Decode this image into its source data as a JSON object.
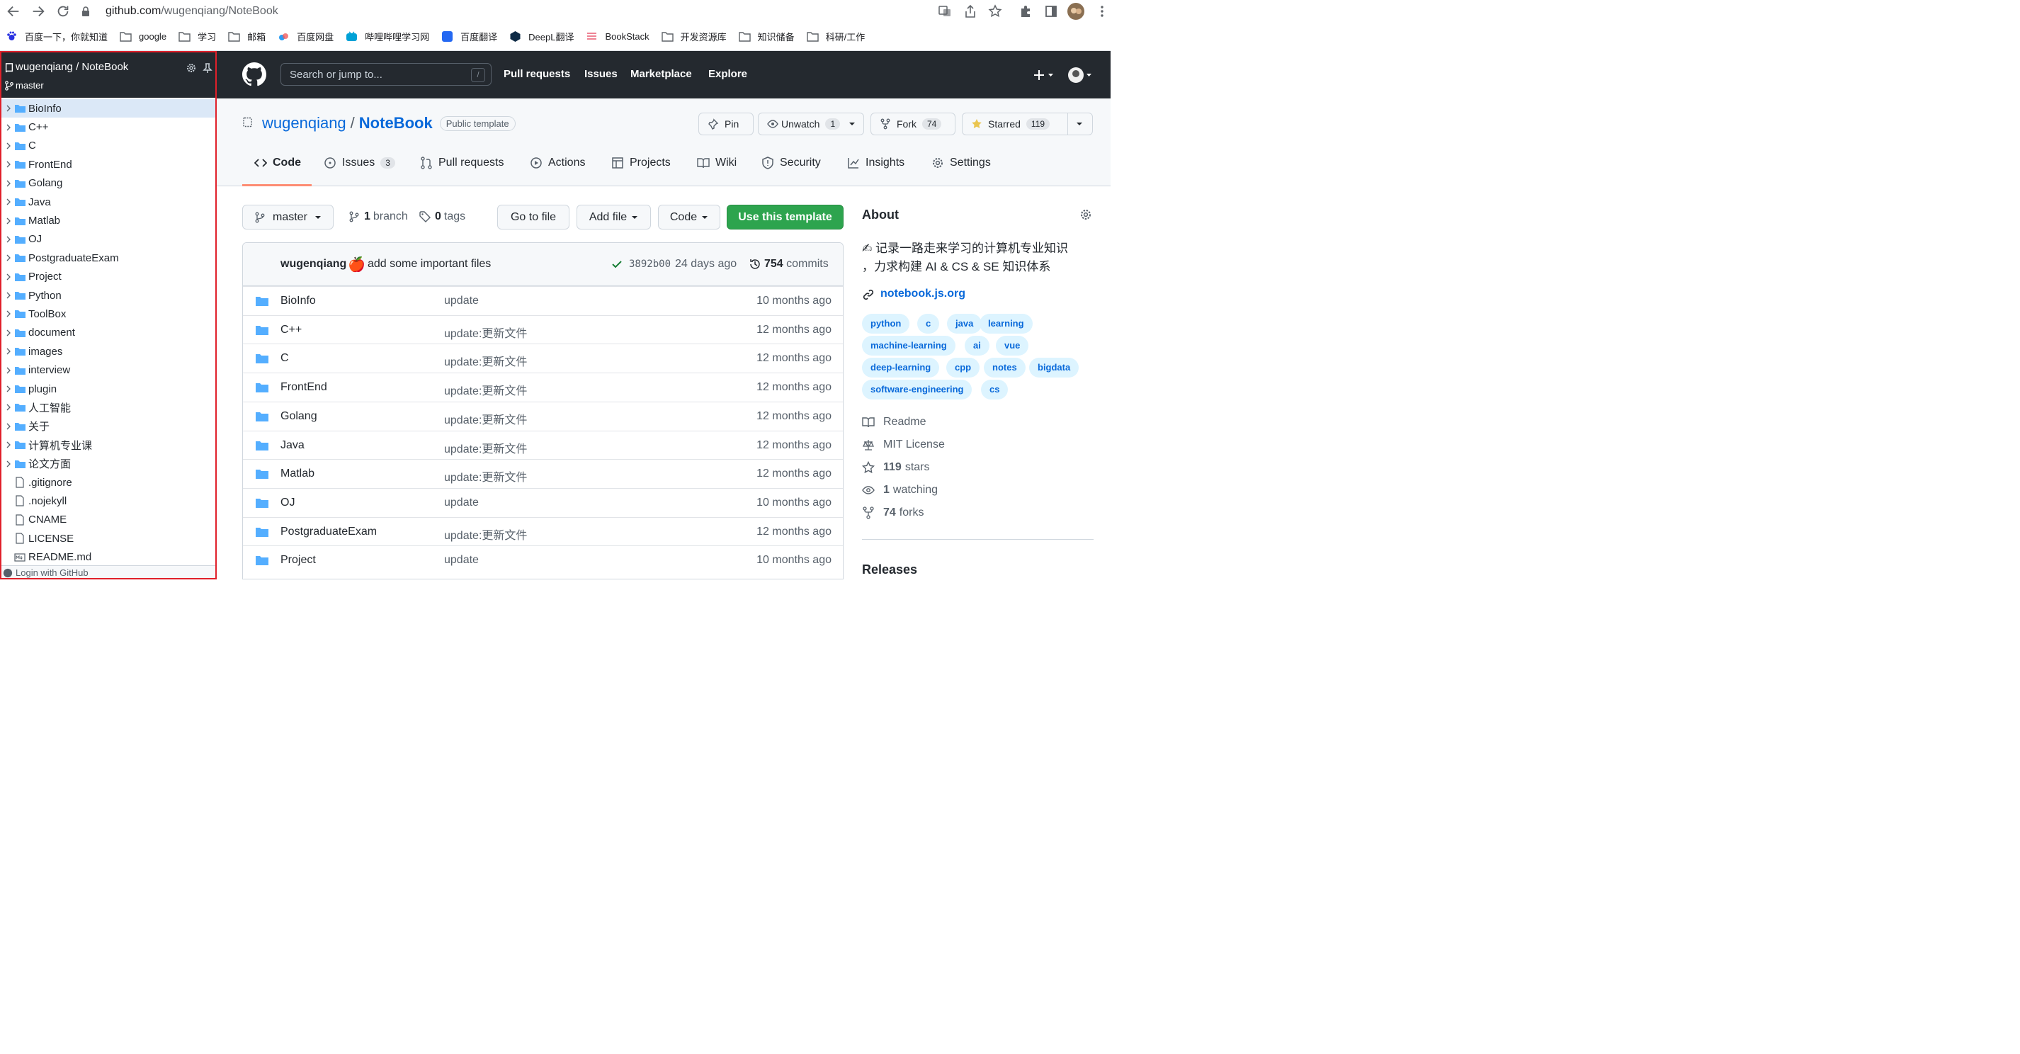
{
  "browser": {
    "url_host": "github.com",
    "url_path": "/wugenqiang/NoteBook",
    "bookmarks": [
      "百度一下，你就知道",
      "google",
      "学习",
      "邮箱",
      "百度网盘",
      "哔哩哔哩学习网",
      "百度翻译",
      "DeepL翻译",
      "BookStack",
      "开发资源库",
      "知识储备",
      "科研/工作"
    ]
  },
  "sidebar": {
    "repo_title": "wugenqiang / NoteBook",
    "branch": "master",
    "items": [
      {
        "label": "BioInfo",
        "type": "folder",
        "selected": true
      },
      {
        "label": "C++",
        "type": "folder"
      },
      {
        "label": "C",
        "type": "folder"
      },
      {
        "label": "FrontEnd",
        "type": "folder"
      },
      {
        "label": "Golang",
        "type": "folder"
      },
      {
        "label": "Java",
        "type": "folder"
      },
      {
        "label": "Matlab",
        "type": "folder"
      },
      {
        "label": "OJ",
        "type": "folder"
      },
      {
        "label": "PostgraduateExam",
        "type": "folder"
      },
      {
        "label": "Project",
        "type": "folder"
      },
      {
        "label": "Python",
        "type": "folder"
      },
      {
        "label": "ToolBox",
        "type": "folder"
      },
      {
        "label": "document",
        "type": "folder"
      },
      {
        "label": "images",
        "type": "folder"
      },
      {
        "label": "interview",
        "type": "folder"
      },
      {
        "label": "plugin",
        "type": "folder"
      },
      {
        "label": "人工智能",
        "type": "folder"
      },
      {
        "label": "关于",
        "type": "folder"
      },
      {
        "label": "计算机专业课",
        "type": "folder"
      },
      {
        "label": "论文方面",
        "type": "folder"
      },
      {
        "label": ".gitignore",
        "type": "file"
      },
      {
        "label": ".nojekyll",
        "type": "file"
      },
      {
        "label": "CNAME",
        "type": "file"
      },
      {
        "label": "LICENSE",
        "type": "file"
      },
      {
        "label": "README.md",
        "type": "md"
      }
    ],
    "footer": "Login with GitHub"
  },
  "header": {
    "search_placeholder": "Search or jump to...",
    "search_key": "/",
    "nav": [
      "Pull requests",
      "Issues",
      "Marketplace",
      "Explore"
    ]
  },
  "repo": {
    "owner": "wugenqiang",
    "separator": "/",
    "name": "NoteBook",
    "badge": "Public template",
    "pin": "Pin",
    "unwatch": "Unwatch",
    "watch_count": "1",
    "fork": "Fork",
    "fork_count": "74",
    "starred": "Starred",
    "star_count": "119",
    "tabs": {
      "code": "Code",
      "issues": "Issues",
      "issues_count": "3",
      "pulls": "Pull requests",
      "actions": "Actions",
      "projects": "Projects",
      "wiki": "Wiki",
      "security": "Security",
      "insights": "Insights",
      "settings": "Settings"
    }
  },
  "main": {
    "branch": "master",
    "branch_count": "1",
    "branch_word": "branch",
    "tag_count": "0",
    "tag_word": "tags",
    "go_to_file": "Go to file",
    "add_file": "Add file",
    "code": "Code",
    "use_template": "Use this template",
    "commit": {
      "author": "wugenqiang",
      "emoji": "🍎",
      "message": "add some important files",
      "hash": "3892b00",
      "age": "24 days ago",
      "count": "754",
      "count_word": "commits"
    },
    "files": [
      {
        "name": "BioInfo",
        "message": "update",
        "age": "10 months ago"
      },
      {
        "name": "C++",
        "message": "update:更新文件",
        "age": "12 months ago"
      },
      {
        "name": "C",
        "message": "update:更新文件",
        "age": "12 months ago"
      },
      {
        "name": "FrontEnd",
        "message": "update:更新文件",
        "age": "12 months ago"
      },
      {
        "name": "Golang",
        "message": "update:更新文件",
        "age": "12 months ago"
      },
      {
        "name": "Java",
        "message": "update:更新文件",
        "age": "12 months ago"
      },
      {
        "name": "Matlab",
        "message": "update:更新文件",
        "age": "12 months ago"
      },
      {
        "name": "OJ",
        "message": "update",
        "age": "10 months ago"
      },
      {
        "name": "PostgraduateExam",
        "message": "update:更新文件",
        "age": "12 months ago"
      },
      {
        "name": "Project",
        "message": "update",
        "age": "10 months ago"
      }
    ]
  },
  "about": {
    "heading": "About",
    "description_line1": "✍ 记录一路走来学习的计算机专业知识",
    "description_line2": "，力求构建 AI & CS & SE 知识体系",
    "link": "notebook.js.org",
    "topics": [
      "python",
      "c",
      "java",
      "learning",
      "machine-learning",
      "ai",
      "vue",
      "deep-learning",
      "cpp",
      "notes",
      "bigdata",
      "software-engineering",
      "cs"
    ],
    "readme": "Readme",
    "license": "MIT License",
    "stars_count": "119",
    "stars_word": "stars",
    "watching_count": "1",
    "watching_word": "watching",
    "forks_count": "74",
    "forks_word": "forks",
    "releases": "Releases"
  },
  "colors": {
    "header_bg": "#24292f",
    "accent_link": "#0969da",
    "green_button": "#2da44e",
    "annotation_red": "#e0202a",
    "folder": "#54aeff"
  }
}
